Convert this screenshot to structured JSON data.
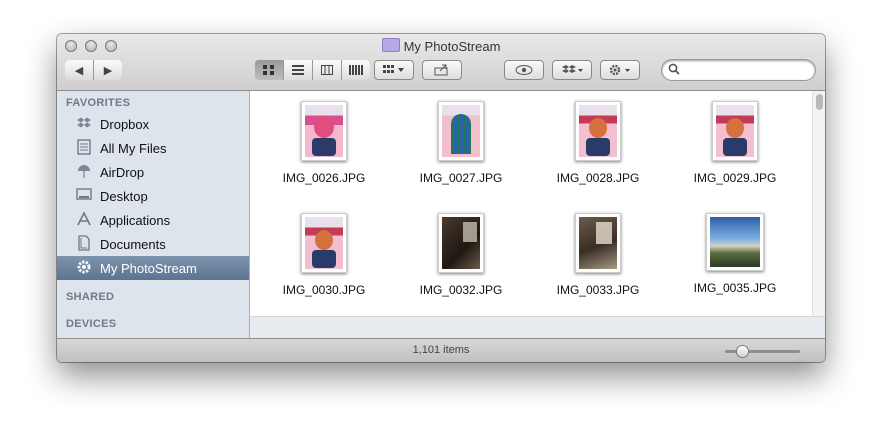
{
  "window": {
    "title": "My PhotoStream",
    "status": "1,101 items"
  },
  "toolbar": {
    "back_icon": "◀",
    "forward_icon": "▶",
    "view_icons": [
      "icon-view-icon",
      "list-view-icon",
      "column-view-icon",
      "coverflow-view-icon"
    ],
    "arrange_icon": "arrange-icon",
    "share_icon": "share-icon",
    "quicklook_icon": "eye-icon",
    "dropbox_icon": "dropbox-icon",
    "action_icon": "gear-icon",
    "search_value": "",
    "search_placeholder": ""
  },
  "sidebar": {
    "favorites_label": "FAVORITES",
    "shared_label": "SHARED",
    "devices_label": "DEVICES",
    "items": [
      {
        "label": "Dropbox",
        "icon": "dropbox-icon",
        "selected": false
      },
      {
        "label": "All My Files",
        "icon": "all-files-icon",
        "selected": false
      },
      {
        "label": "AirDrop",
        "icon": "airdrop-icon",
        "selected": false
      },
      {
        "label": "Desktop",
        "icon": "desktop-icon",
        "selected": false
      },
      {
        "label": "Applications",
        "icon": "applications-icon",
        "selected": false
      },
      {
        "label": "Documents",
        "icon": "documents-icon",
        "selected": false
      },
      {
        "label": "My PhotoStream",
        "icon": "gear-icon",
        "selected": true
      }
    ]
  },
  "files": [
    {
      "name": "IMG_0026.JPG",
      "kind": "portrait"
    },
    {
      "name": "IMG_0027.JPG",
      "kind": "portrait"
    },
    {
      "name": "IMG_0028.JPG",
      "kind": "portrait"
    },
    {
      "name": "IMG_0029.JPG",
      "kind": "portrait"
    },
    {
      "name": "IMG_0030.JPG",
      "kind": "portrait"
    },
    {
      "name": "IMG_0032.JPG",
      "kind": "portrait"
    },
    {
      "name": "IMG_0033.JPG",
      "kind": "portrait"
    },
    {
      "name": "IMG_0035.JPG",
      "kind": "landscape"
    }
  ],
  "colors": {
    "selection": "#5d7491",
    "sidebar": "#dde4ec"
  }
}
